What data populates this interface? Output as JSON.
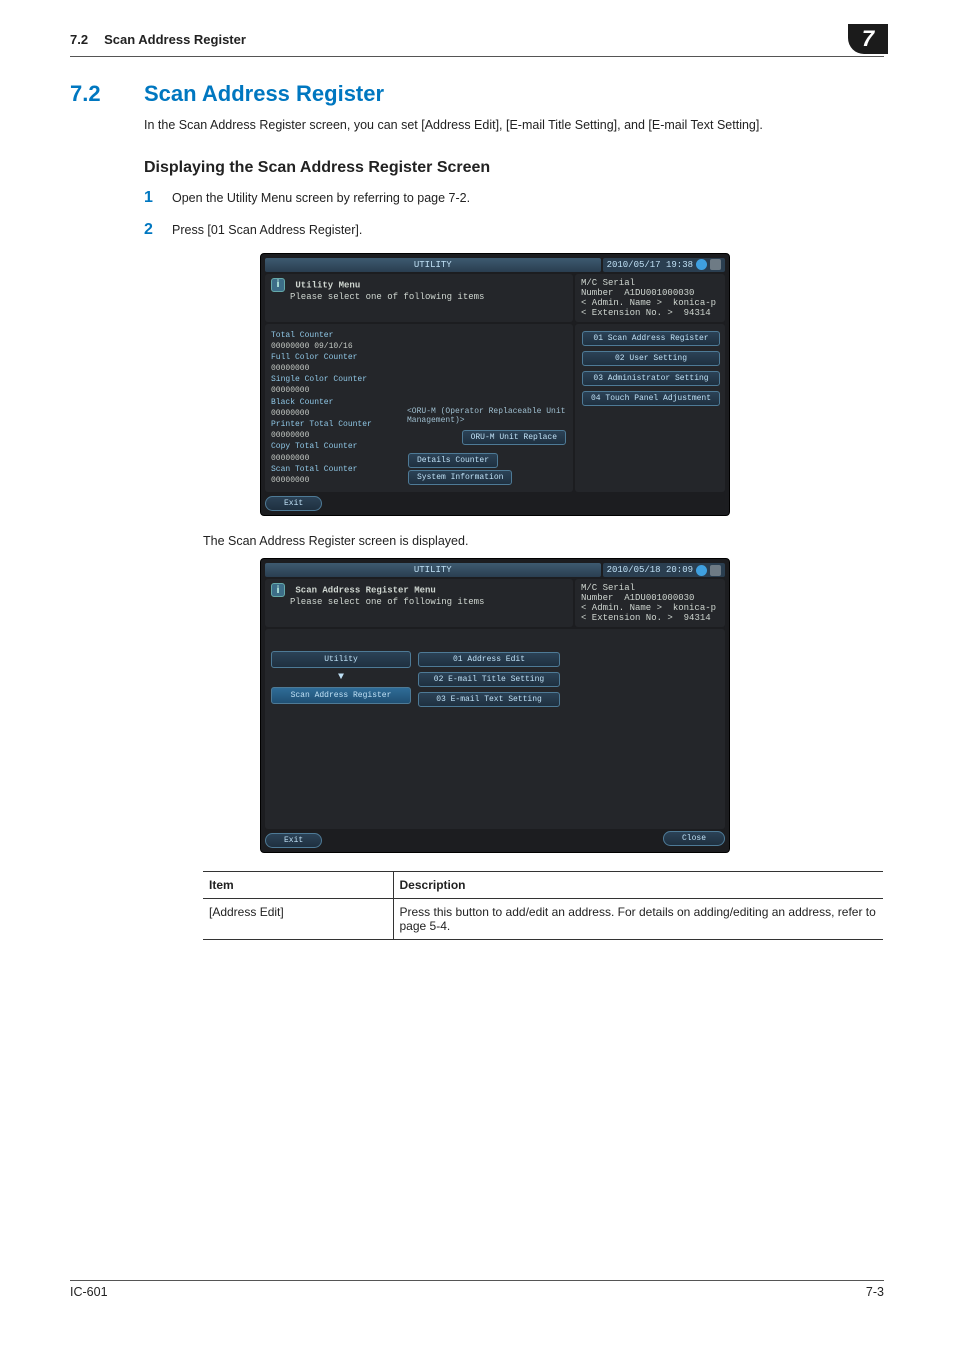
{
  "header": {
    "section_num": "7.2",
    "section_title": "Scan Address Register",
    "chapter": "7"
  },
  "heading": {
    "num": "7.2",
    "title": "Scan Address Register"
  },
  "intro": "In the Scan Address Register screen, you can set [Address Edit], [E-mail Title Setting], and [E-mail Text Setting].",
  "subheading": "Displaying the Scan Address Register Screen",
  "steps": [
    {
      "n": "1",
      "text": "Open the Utility Menu screen by referring to page 7-2."
    },
    {
      "n": "2",
      "text": "Press [01 Scan Address Register]."
    }
  ],
  "screen1": {
    "titlebar": "UTILITY",
    "clock": "2010/05/17 19:38",
    "info_title": "Utility Menu",
    "info_sub": "Please select one of following items",
    "right_info": {
      "serial_label": "M/C Serial Number",
      "serial": "A1DU001000030",
      "admin_label": "< Admin. Name >",
      "admin": "konica-p",
      "ext_label": "< Extension No. >",
      "ext": "94314"
    },
    "counters": [
      {
        "label": "Total Counter",
        "value": "00000000   09/10/16"
      },
      {
        "label": "Full Color Counter",
        "value": "00000000"
      },
      {
        "label": "Single Color Counter",
        "value": "00000000"
      },
      {
        "label": "Black Counter",
        "value": "00000000"
      },
      {
        "label": "Printer Total Counter",
        "value": "00000000"
      },
      {
        "label": "Copy Total Counter",
        "value": "00000000"
      },
      {
        "label": "Scan Total Counter",
        "value": "00000000"
      }
    ],
    "oru_note": "<ORU-M (Operator Replaceable Unit Management)>",
    "oru_btn": "ORU-M Unit Replace",
    "details_btn": "Details Counter",
    "sysinfo_btn": "System Information",
    "menu": [
      "01 Scan Address Register",
      "02 User Setting",
      "03 Administrator Setting",
      "04 Touch Panel Adjustment"
    ],
    "exit": "Exit"
  },
  "mid_caption": "The Scan Address Register screen is displayed.",
  "screen2": {
    "titlebar": "UTILITY",
    "clock": "2010/05/18 20:09",
    "info_title": "Scan Address Register Menu",
    "info_sub": "Please select one of following items",
    "right_info": {
      "serial_label": "M/C Serial Number",
      "serial": "A1DU001000030",
      "admin_label": "< Admin. Name >",
      "admin": "konica-p",
      "ext_label": "< Extension No. >",
      "ext": "94314"
    },
    "nav": [
      "Utility",
      "Scan Address Register"
    ],
    "menu": [
      "01 Address Edit",
      "02 E-mail Title Setting",
      "03 E-mail Text Setting"
    ],
    "exit": "Exit",
    "close": "Close"
  },
  "table": {
    "head_item": "Item",
    "head_desc": "Description",
    "rows": [
      {
        "item": "[Address Edit]",
        "desc": "Press this button to add/edit an address. For details on adding/editing an address, refer to page 5-4."
      }
    ]
  },
  "footer": {
    "left": "IC-601",
    "right": "7-3"
  }
}
